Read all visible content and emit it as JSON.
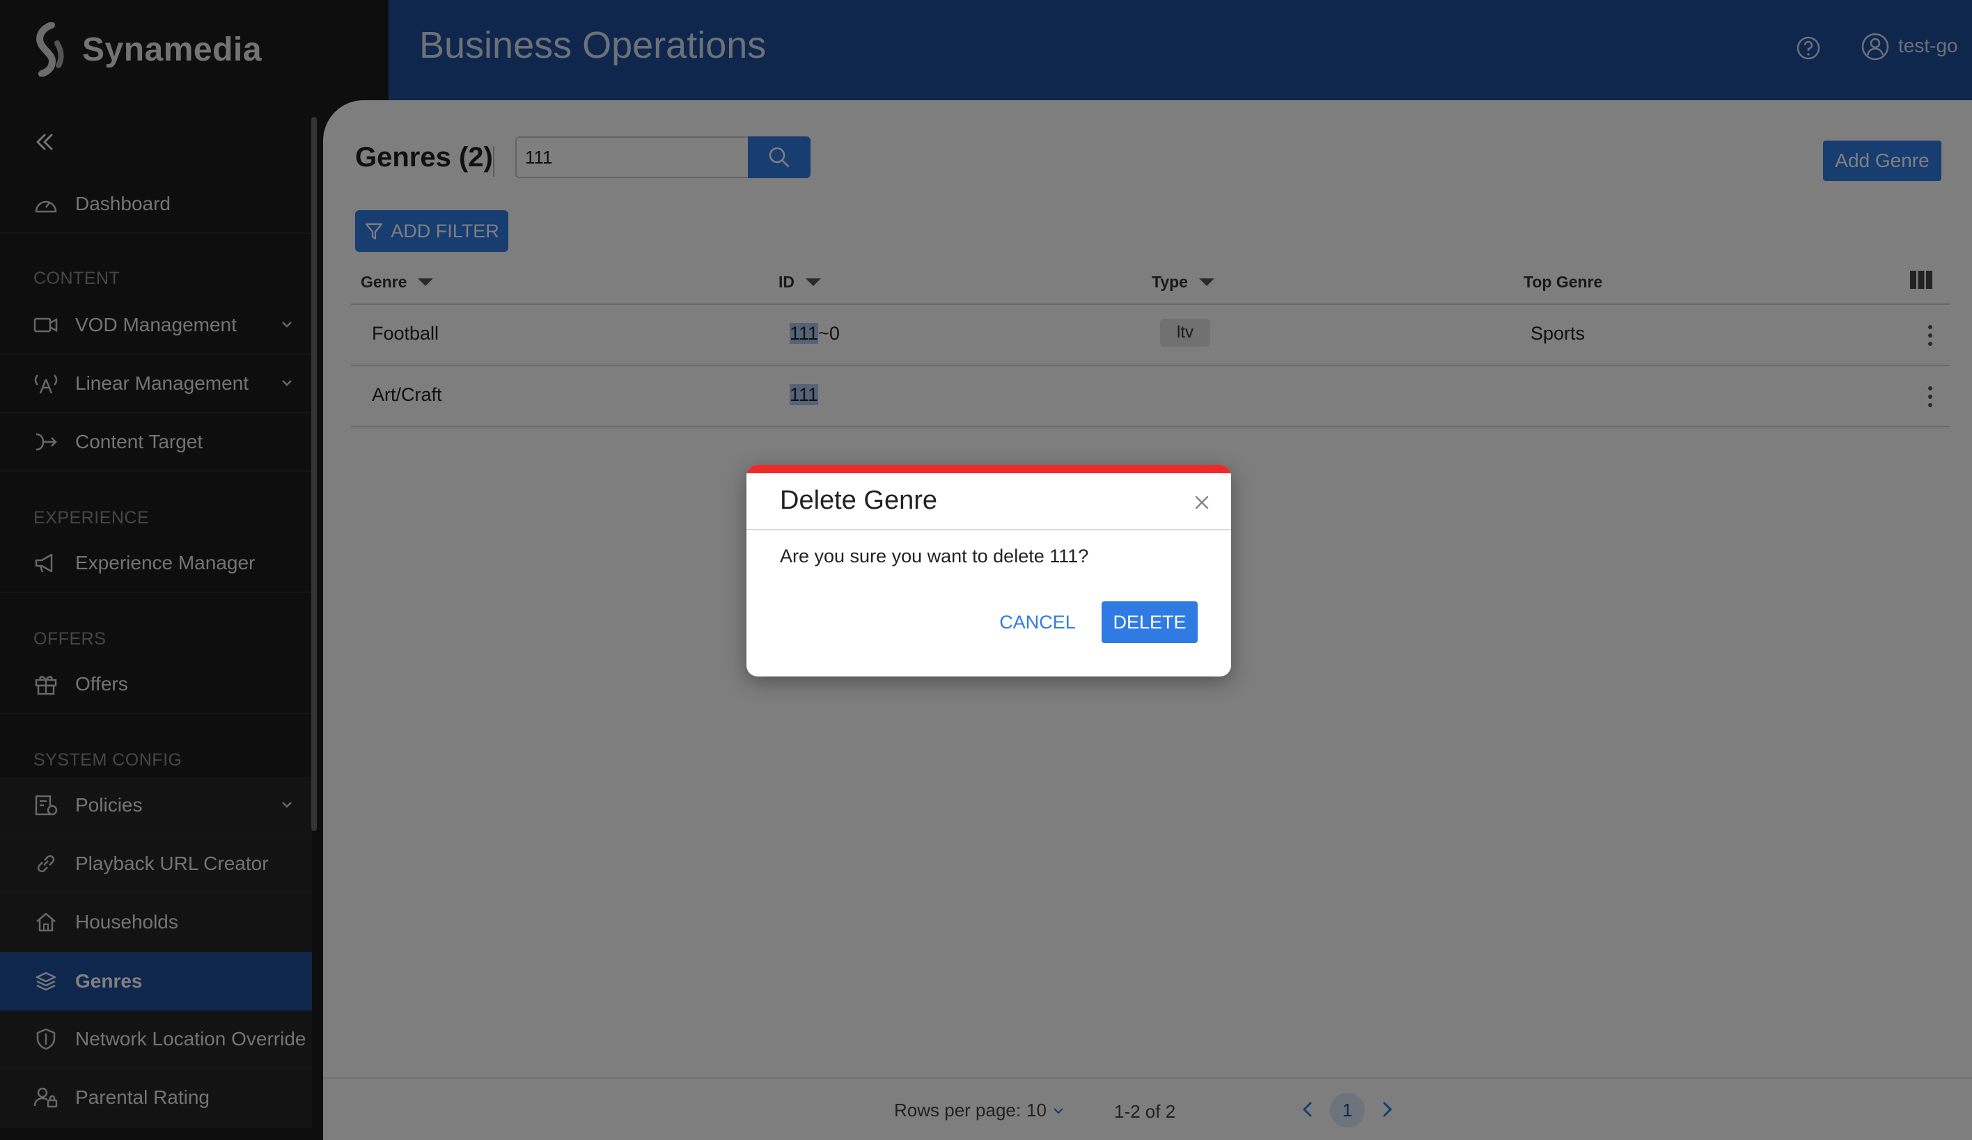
{
  "app": {
    "brand": "Synamedia",
    "header_title": "Business Operations",
    "user": "test-go"
  },
  "sidebar": {
    "items": [
      {
        "label": "Dashboard",
        "icon": "dashboard-icon"
      },
      {
        "section": "CONTENT"
      },
      {
        "label": "VOD Management",
        "icon": "video-icon"
      },
      {
        "label": "Linear Management",
        "icon": "broadcast-icon"
      },
      {
        "label": "Content Target",
        "icon": "arrow-target-icon"
      },
      {
        "section": "EXPERIENCE"
      },
      {
        "label": "Experience Manager",
        "icon": "megaphone-icon"
      },
      {
        "section": "OFFERS"
      },
      {
        "label": "Offers",
        "icon": "gift-icon"
      },
      {
        "section": "SYSTEM CONFIG"
      },
      {
        "label": "Policies",
        "icon": "policy-icon"
      },
      {
        "label": "Playback URL Creator",
        "icon": "link-icon"
      },
      {
        "label": "Households",
        "icon": "home-icon"
      },
      {
        "label": "Genres",
        "icon": "layers-icon",
        "active": true
      },
      {
        "label": "Network Location Override",
        "icon": "shield-icon"
      },
      {
        "label": "Parental Rating",
        "icon": "user-lock-icon"
      }
    ]
  },
  "page": {
    "title": "Genres (2)",
    "search_value": "111",
    "add_button": "Add Genre",
    "filter_button": "ADD FILTER"
  },
  "table": {
    "columns": [
      "Genre",
      "ID",
      "Type",
      "Top Genre"
    ],
    "rows": [
      {
        "genre": "Football",
        "id_match": "111",
        "id_rest": "~0",
        "type": "ltv",
        "top_genre": "Sports"
      },
      {
        "genre": "Art/Craft",
        "id_match": "111",
        "id_rest": "",
        "type": "",
        "top_genre": ""
      }
    ]
  },
  "pagination": {
    "rows_per_page_label": "Rows per page:",
    "rows_per_page": "10",
    "range": "1-2 of 2",
    "current_page": "1"
  },
  "modal": {
    "title": "Delete Genre",
    "message": "Are you sure you want to delete 111?",
    "cancel": "CANCEL",
    "delete": "DELETE"
  },
  "colors": {
    "brand_blue": "#1f4d9a",
    "accent": "#2f7be3",
    "danger": "#ee2a2a"
  }
}
